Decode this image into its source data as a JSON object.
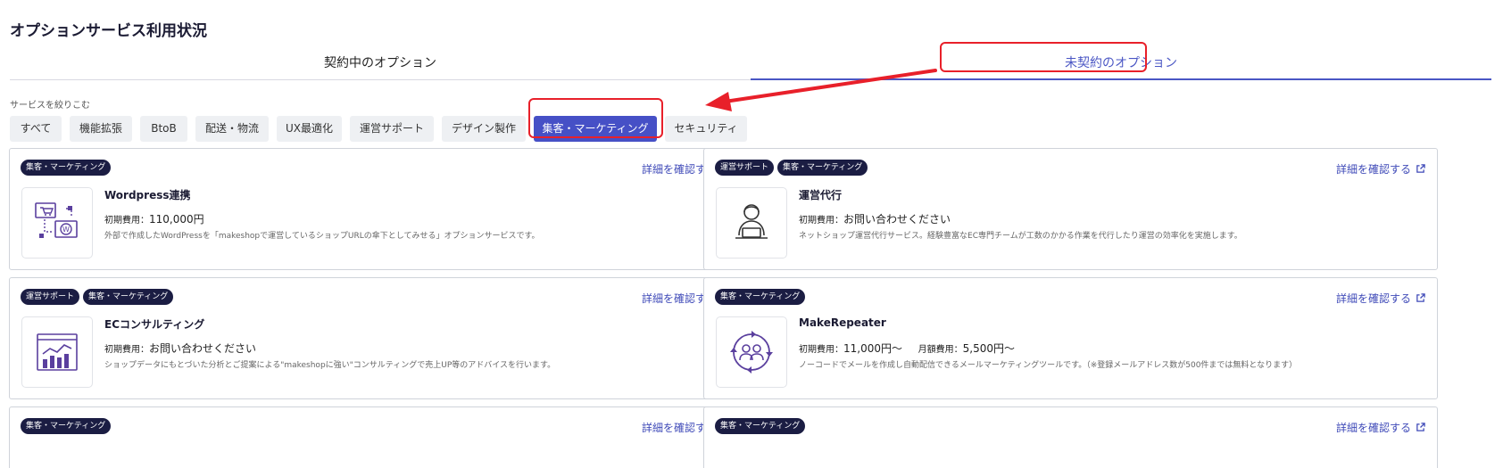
{
  "page": {
    "title": "オプションサービス利用状況"
  },
  "tabs": [
    {
      "label": "契約中のオプション",
      "active": false
    },
    {
      "label": "未契約のオプション",
      "active": true
    }
  ],
  "filter": {
    "label": "サービスを絞りこむ",
    "chips": [
      {
        "label": "すべて",
        "active": false
      },
      {
        "label": "機能拡張",
        "active": false
      },
      {
        "label": "BtoB",
        "active": false
      },
      {
        "label": "配送・物流",
        "active": false
      },
      {
        "label": "UX最適化",
        "active": false
      },
      {
        "label": "運営サポート",
        "active": false
      },
      {
        "label": "デザイン製作",
        "active": false
      },
      {
        "label": "集客・マーケティング",
        "active": true
      },
      {
        "label": "セキュリティ",
        "active": false
      }
    ]
  },
  "colors": {
    "accent": "#4650c6",
    "tag_bg": "#1b1d43",
    "annotation": "#e8202a"
  },
  "detail_link_label": "詳細を確認する",
  "cards": [
    {
      "tags": [
        "集客・マーケティング"
      ],
      "name": "Wordpress連携",
      "price_label": "初期費用：",
      "price": "110,000円",
      "price2_label": "",
      "price2": "",
      "description": "外部で作成したWordPressを「makeshopで運営しているショップURLの傘下としてみせる」オプションサービスです。",
      "icon": "wordpress-integration-icon"
    },
    {
      "tags": [
        "運営サポート",
        "集客・マーケティング"
      ],
      "name": "運営代行",
      "price_label": "初期費用：",
      "price": "お問い合わせください",
      "price2_label": "",
      "price2": "",
      "description": "ネットショップ運営代行サービス。経験豊富なEC専門チームが工数のかかる作業を代行したり運営の効率化を実施します。",
      "icon": "operator-icon"
    },
    {
      "tags": [
        "運営サポート",
        "集客・マーケティング"
      ],
      "name": "ECコンサルティング",
      "price_label": "初期費用：",
      "price": "お問い合わせください",
      "price2_label": "",
      "price2": "",
      "description": "ショップデータにもとづいた分析とご提案による\"makeshopに強い\"コンサルティングで売上UP等のアドバイスを行います。",
      "icon": "analytics-dashboard-icon"
    },
    {
      "tags": [
        "集客・マーケティング"
      ],
      "name": "MakeRepeater",
      "price_label": "初期費用：",
      "price": "11,000円〜",
      "price2_label": "月額費用：",
      "price2": "5,500円〜",
      "description": "ノーコードでメールを作成し自動配信できるメールマーケティングツールです。（※登録メールアドレス数が500件までは無料となります）",
      "icon": "repeat-users-icon"
    },
    {
      "tags": [
        "集客・マーケティング"
      ]
    },
    {
      "tags": [
        "集客・マーケティング"
      ]
    }
  ]
}
